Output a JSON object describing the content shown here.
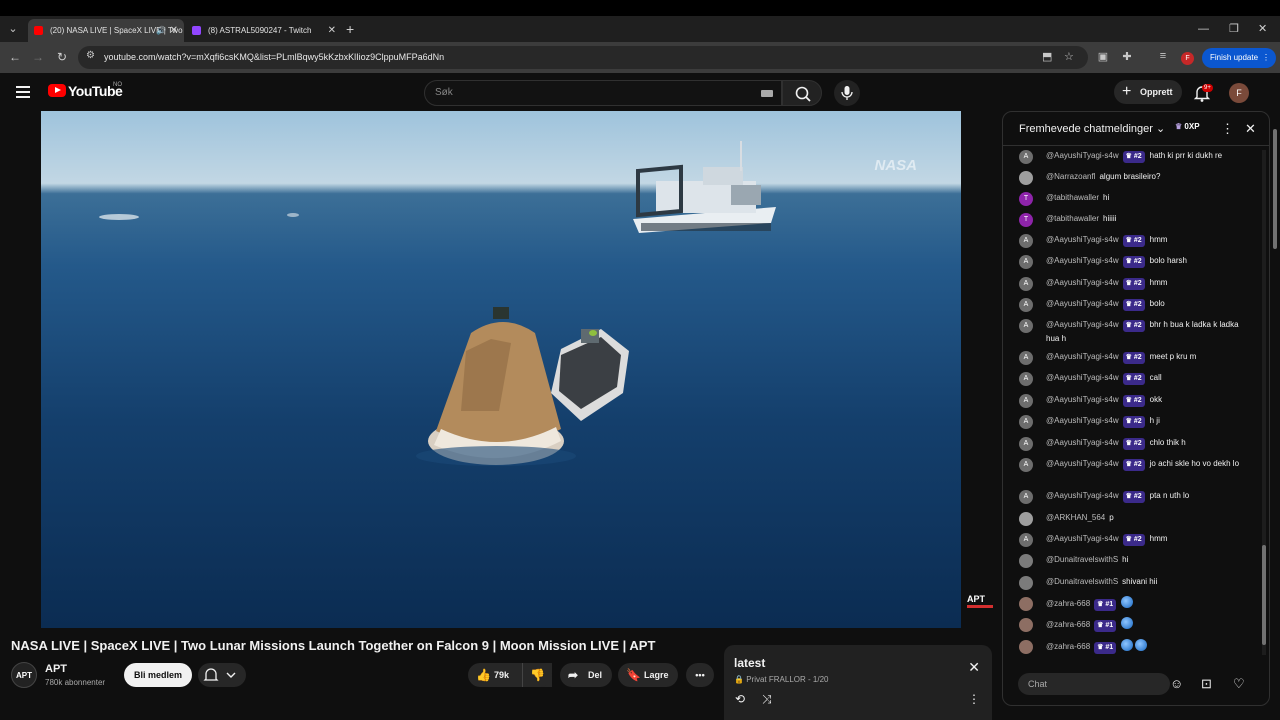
{
  "browser": {
    "tabs": [
      {
        "title": "(20) NASA LIVE | SpaceX LIVE | Two Lunar...",
        "active": true
      },
      {
        "title": "(8) ASTRAL5090247 - Twitch",
        "active": false
      }
    ],
    "url": "youtube.com/watch?v=mXqfi6csKMQ&list=PLmlBqwy5kKzbxKlIioz9ClppuMFPa6dNn",
    "finish_update": "Finish update",
    "profile_initial": "F"
  },
  "youtube": {
    "logo_text": "YouTube",
    "country_code": "NO",
    "search_placeholder": "Søk",
    "create_label": "Opprett",
    "notification_count": "9+",
    "avatar_initial": "F"
  },
  "video": {
    "title": "NASA LIVE | SpaceX LIVE | Two Lunar Missions Launch Together on Falcon 9 | Moon Mission LIVE | APT",
    "watermark_nasa": "NASA",
    "watermark_apt": "APT"
  },
  "channel": {
    "name": "APT",
    "avatar_text": "APT",
    "subscribers": "780k abonnenter",
    "join_label": "Bli medlem"
  },
  "actions": {
    "likes": "79k",
    "share_label": "Del",
    "save_label": "Lagre"
  },
  "playlist": {
    "title": "latest",
    "privacy": "Privat",
    "owner_progress": "FRALLOR - 1/20"
  },
  "chat": {
    "header_title": "Fremhevede chatmeldinger",
    "xp_label": "0XP",
    "input_placeholder": "Chat",
    "messages": [
      {
        "author": "@AayushiTyagi-s4w",
        "badge": "#2",
        "text": "hath ki prr ki dukh re",
        "avatar": "A",
        "color": "#6d6d6d"
      },
      {
        "author": "@Narrazoanfl",
        "badge": "",
        "text": "algum brasileiro?",
        "avatar": "",
        "color": "#9e9e9e"
      },
      {
        "author": "@tabithawaller",
        "badge": "",
        "text": "hi",
        "avatar": "T",
        "color": "#8e24aa"
      },
      {
        "author": "@tabithawaller",
        "badge": "",
        "text": "hiiiii",
        "avatar": "T",
        "color": "#8e24aa"
      },
      {
        "author": "@AayushiTyagi-s4w",
        "badge": "#2",
        "text": "hmm",
        "avatar": "A",
        "color": "#6d6d6d"
      },
      {
        "author": "@AayushiTyagi-s4w",
        "badge": "#2",
        "text": "bolo harsh",
        "avatar": "A",
        "color": "#6d6d6d"
      },
      {
        "author": "@AayushiTyagi-s4w",
        "badge": "#2",
        "text": "hmm",
        "avatar": "A",
        "color": "#6d6d6d"
      },
      {
        "author": "@AayushiTyagi-s4w",
        "badge": "#2",
        "text": "bolo",
        "avatar": "A",
        "color": "#6d6d6d"
      },
      {
        "author": "@AayushiTyagi-s4w",
        "badge": "#2",
        "text": "bhr h bua k ladka k ladka hua h",
        "avatar": "A",
        "color": "#6d6d6d"
      },
      {
        "author": "@AayushiTyagi-s4w",
        "badge": "#2",
        "text": "meet p kru m",
        "avatar": "A",
        "color": "#6d6d6d"
      },
      {
        "author": "@AayushiTyagi-s4w",
        "badge": "#2",
        "text": "call",
        "avatar": "A",
        "color": "#6d6d6d"
      },
      {
        "author": "@AayushiTyagi-s4w",
        "badge": "#2",
        "text": "okk",
        "avatar": "A",
        "color": "#6d6d6d"
      },
      {
        "author": "@AayushiTyagi-s4w",
        "badge": "#2",
        "text": "h ji",
        "avatar": "A",
        "color": "#6d6d6d"
      },
      {
        "author": "@AayushiTyagi-s4w",
        "badge": "#2",
        "text": "chlo thik h",
        "avatar": "A",
        "color": "#6d6d6d"
      },
      {
        "author": "@AayushiTyagi-s4w",
        "badge": "#2",
        "text": "jo achi skle ho vo dekh lo",
        "avatar": "A",
        "color": "#6d6d6d"
      },
      {
        "author": "@AayushiTyagi-s4w",
        "badge": "#2",
        "text": "pta n uth lo",
        "avatar": "A",
        "color": "#6d6d6d"
      },
      {
        "author": "@ARKHAN_564",
        "badge": "",
        "text": "p",
        "avatar": "",
        "color": "#9e9e9e"
      },
      {
        "author": "@AayushiTyagi-s4w",
        "badge": "#2",
        "text": "hmm",
        "avatar": "A",
        "color": "#6d6d6d"
      },
      {
        "author": "@DunaitravelswithS",
        "badge": "",
        "text": "hi",
        "avatar": "",
        "color": "#7b7b7b"
      },
      {
        "author": "@DunaitravelswithS",
        "badge": "",
        "text": "shivani hii",
        "avatar": "",
        "color": "#7b7b7b"
      },
      {
        "author": "@zahra-668",
        "badge": "#1",
        "text": "",
        "avatar": "",
        "color": "#8d6e63"
      },
      {
        "author": "@zahra-668",
        "badge": "#1",
        "text": "",
        "avatar": "",
        "color": "#8d6e63"
      },
      {
        "author": "@zahra-668",
        "badge": "#1",
        "text": "",
        "avatar": "",
        "color": "#8d6e63"
      }
    ]
  },
  "colors": {
    "accent_blue": "#0b57d0",
    "youtube_red": "#ff0000",
    "badge_purple": "#3b2a8a"
  }
}
